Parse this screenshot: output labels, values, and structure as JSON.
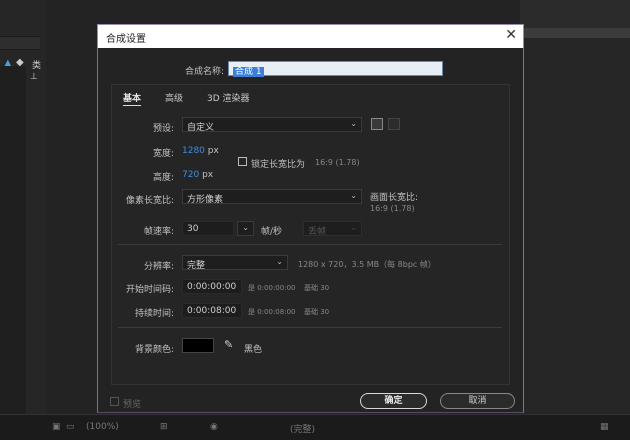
{
  "dialog": {
    "title": "合成设置",
    "close_symbol": "✕",
    "name_label": "合成名称:",
    "name_value": "合成 1"
  },
  "tabs": [
    {
      "label": "基本"
    },
    {
      "label": "高级"
    },
    {
      "label": "3D 渲染器"
    }
  ],
  "basic": {
    "preset_label": "预设:",
    "preset_value": "自定义",
    "width_label": "宽度:",
    "width_value": "1280",
    "width_unit": "px",
    "height_label": "高度:",
    "height_value": "720",
    "height_unit": "px",
    "lock_label": "锁定长宽比为",
    "lock_ratio": "16:9 (1.78)",
    "pixel_aspect_label": "像素长宽比:",
    "pixel_aspect_value": "方形像素",
    "frame_aspect_label": "画面长宽比:",
    "frame_aspect_value": "16:9 (1.78)",
    "fps_label": "帧速率:",
    "fps_value": "30",
    "fps_unit": "帧/秒",
    "drop_frame_value": "丢帧",
    "resolution_label": "分辨率:",
    "resolution_value": "完整",
    "resolution_info": "1280 x 720，3.5 MB（每 8bpc 帧）",
    "start_tc_label": "开始时间码:",
    "start_tc_value": "0:00:00:00",
    "start_tc_info_a": "是 0:00:00:00",
    "start_tc_info_b": "基础 30",
    "duration_label": "持续时间:",
    "duration_value": "0:00:08:00",
    "duration_info_a": "是 0:00:08:00",
    "duration_info_b": "基础 30",
    "bg_color_label": "背景颜色:",
    "bg_color_name": "黑色",
    "bg_color_hex": "#000000"
  },
  "footer": {
    "preview_label": "预览",
    "ok_label": "确定",
    "cancel_label": "取消"
  },
  "background_app": {
    "panel_label": "类",
    "zoom_value": "(100%)",
    "quality_value": "(完整)"
  }
}
